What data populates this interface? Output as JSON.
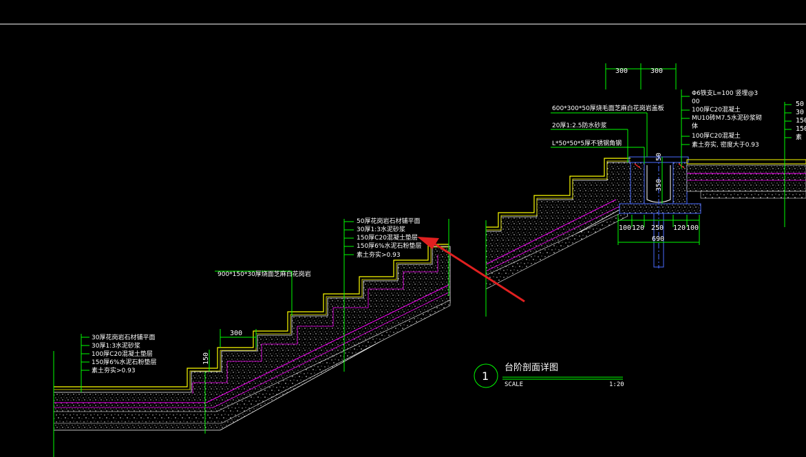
{
  "colors": {
    "background": "#000000",
    "line_white": "#ffffff",
    "dim_green": "#00ff00",
    "paving_yellow": "#ffff00",
    "layer_magenta": "#ff00ff",
    "detail_blue": "#4a6bff",
    "arrow_red": "#e02020"
  },
  "labels": {
    "left_layers": [
      "30厚花岗岩石材铺平面",
      "30厚1:3水泥砂浆",
      "100厚C20混凝土垫层",
      "150厚6%水泥石粉垫层",
      "素土夯实>0.93"
    ],
    "mid_layers": [
      "50厚花岗岩石材铺平面",
      "30厚1:3水泥砂浆",
      "150厚C20混凝土垫层",
      "150厚6%水泥石粉垫层",
      "素土夯实>0.93"
    ],
    "step_label": "900*150*30厚烧面芝麻白花岗岩",
    "drain_cover": "600*300*50厚烧毛面芝麻白花岗岩盖板",
    "waterproof": "20厚1:2.5防水砂浆",
    "angle": "L*50*50*5厚不锈钢角钢",
    "right_layers": [
      "Φ6铁支L=100 竖埋@3",
      "00",
      "100厚C20混凝土",
      "MU10砖M7.5水泥砂浆砌",
      "体",
      "100厚C20混凝土",
      "素土夯实, 密度大于0.93"
    ],
    "right_edge": [
      "50",
      "30",
      "150",
      "150",
      "素"
    ]
  },
  "dimensions": {
    "top_300_a": "300",
    "top_300_b": "300",
    "tread": "300",
    "riser": "150",
    "d50": "50",
    "d350": "350",
    "bottom": [
      "100",
      "120",
      "250",
      "120",
      "100"
    ],
    "total": "690"
  },
  "title_block": {
    "number": "1",
    "title": "台阶剖面详图",
    "scale_label": "SCALE",
    "scale_value": "1:20"
  }
}
